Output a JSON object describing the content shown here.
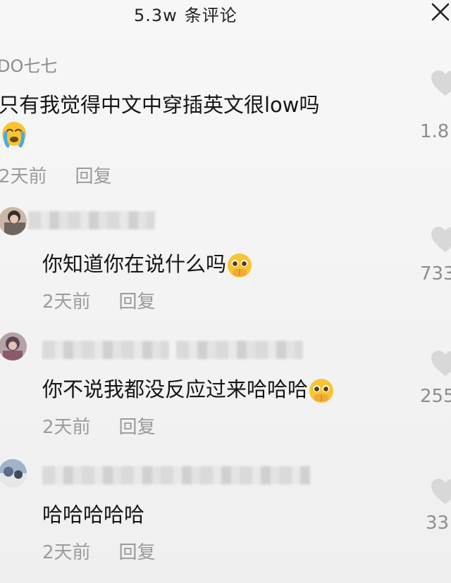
{
  "header": {
    "count": "5.3w",
    "label": "条评论"
  },
  "comments": [
    {
      "username": "DO七七",
      "text": "只有我觉得中文中穿插英文很low吗",
      "time": "2天前",
      "reply": "回复",
      "likes": "1.8",
      "emoji": "crying-face"
    },
    {
      "username": "",
      "text": "你知道你在说什么吗",
      "time": "2天前",
      "reply": "回复",
      "likes": "733",
      "emoji": "pleading-face"
    },
    {
      "username": "",
      "text": "你不说我都没反应过来哈哈哈",
      "time": "2天前",
      "reply": "回复",
      "likes": "255",
      "emoji": "pleading-face"
    },
    {
      "username": "",
      "text": "哈哈哈哈哈",
      "time": "2天前",
      "reply": "回复",
      "likes": "33"
    }
  ],
  "colors": {
    "background": "#f4f4f4",
    "text": "#151515",
    "secondary": "#9c9c9c",
    "heart": "#d8d8d8"
  }
}
